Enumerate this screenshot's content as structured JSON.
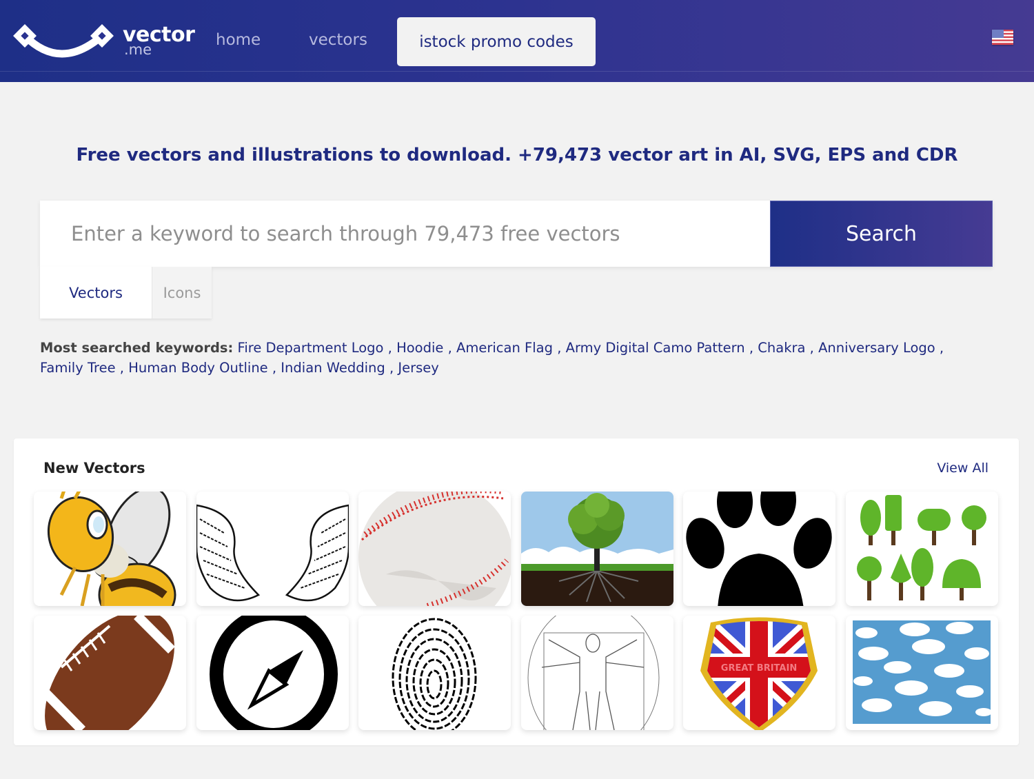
{
  "header": {
    "logo": {
      "word": "vector",
      "sub": ".me"
    },
    "nav": [
      {
        "label": "home"
      },
      {
        "label": "vectors"
      },
      {
        "label": "istock promo codes",
        "highlighted": true
      }
    ],
    "language_flag": "us-flag-icon"
  },
  "tagline": {
    "plain": "Free vectors and illustrations to download. ",
    "bold": "+79,473 vector art in AI, SVG, EPS and CDR"
  },
  "search": {
    "placeholder": "Enter a keyword to search through 79,473 free vectors",
    "value": "",
    "button_label": "Search",
    "tabs": [
      {
        "label": "Vectors",
        "active": true
      },
      {
        "label": "Icons",
        "active": false
      }
    ]
  },
  "keywords": {
    "label": "Most searched keywords:",
    "items": [
      "Fire Department Logo",
      "Hoodie",
      "American Flag",
      "Army Digital Camo Pattern",
      "Chakra",
      "Anniversary Logo",
      "Family Tree",
      "Human Body Outline",
      "Indian Wedding",
      "Jersey"
    ],
    "separator": " , "
  },
  "new_vectors": {
    "title": "New Vectors",
    "view_all_label": "View All",
    "items": [
      {
        "subject": "cartoon bee"
      },
      {
        "subject": "angel wings"
      },
      {
        "subject": "baseball"
      },
      {
        "subject": "tree with roots"
      },
      {
        "subject": "paw print"
      },
      {
        "subject": "green trees set"
      },
      {
        "subject": "american football"
      },
      {
        "subject": "compass icon"
      },
      {
        "subject": "fingerprint"
      },
      {
        "subject": "vitruvian man outline"
      },
      {
        "subject": "great britain shield",
        "text": "GREAT BRITAIN"
      },
      {
        "subject": "clouds pattern"
      }
    ]
  },
  "colors": {
    "brand_dark": "#1e2f87",
    "brand_purple": "#463b93",
    "page_bg": "#f2f2f2",
    "link": "#1f2a80"
  }
}
